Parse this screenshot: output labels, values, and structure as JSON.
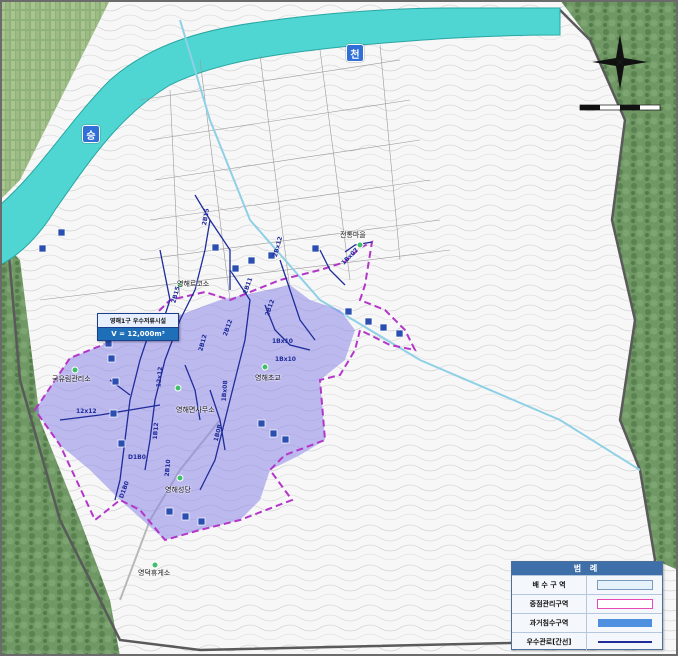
{
  "river_signs": [
    "천",
    "승"
  ],
  "callout": {
    "name": "영해1구 우수저류시설",
    "volume": "V = 12,000m³"
  },
  "place_labels": {
    "youth_center": "국유림관리소",
    "yeonghae_area": "영해르코소",
    "yeonghae_office": "영해면사무소",
    "yeonghae_school": "영해초교",
    "yeonghae_center": "영해성당",
    "jeontong_village": "전통마을",
    "yeongdeok_bureau": "영덕휴게소"
  },
  "pipe_labels": {
    "p1": "2B15",
    "p2": "2B15",
    "p3": "2B12",
    "p4": "2B12",
    "p5": "2B12",
    "p6": "2B11",
    "p7": "1B12",
    "p8": "12x12",
    "p9": "12x12",
    "p10": "1Bx08",
    "p11": "1Bx10",
    "p12": "1Bx10",
    "p13": "2Bx12",
    "p14": "1Bx07",
    "p15": "1B0B",
    "p16": "D1B0",
    "p17": "D1B0",
    "p18": "2B10"
  },
  "legend": {
    "title": "범 례",
    "items": [
      {
        "label": "배 수 구 역",
        "swatch": "drainage-area",
        "color": "#e6f2fb"
      },
      {
        "label": "중점관리구역",
        "swatch": "priority-area",
        "color": "#e64bb5"
      },
      {
        "label": "과거침수구역",
        "swatch": "flood-area",
        "color": "#4f8fe0"
      },
      {
        "label": "우수관로[간선]",
        "swatch": "trunk-line",
        "color": "#1f2c9a"
      }
    ]
  },
  "colors": {
    "river": "#4fd6d3",
    "flood_area": "#8d86ea",
    "priority_boundary": "#b336c9",
    "trunk_line": "#1f2c9a",
    "forest": "#5f8a5a"
  }
}
